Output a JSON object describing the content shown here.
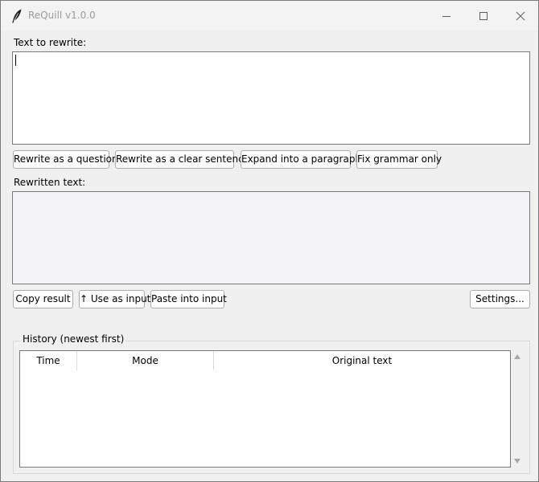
{
  "window": {
    "title": "ReQuill v1.0.0",
    "app_icon": "quill-icon"
  },
  "input": {
    "label": "Text to rewrite:",
    "value": ""
  },
  "rewrite_buttons": {
    "question": "Rewrite as a question",
    "clear_sentence": "Rewrite as a clear sentence",
    "expand": "Expand into a paragraph",
    "fix_grammar": "Fix grammar only"
  },
  "output": {
    "label": "Rewritten text:",
    "value": ""
  },
  "action_buttons": {
    "copy": "Copy result",
    "use_as_input": "↑ Use as input",
    "paste": "Paste into input",
    "settings": "Settings..."
  },
  "history": {
    "title": "History (newest first)",
    "columns": [
      "Time",
      "Mode",
      "Original text"
    ],
    "rows": []
  },
  "colors": {
    "window_bg": "#f0f0f0",
    "input_bg": "#ffffff",
    "output_bg": "#f3f2f7",
    "border": "#7a7a7a",
    "button_border": "#adadad"
  }
}
